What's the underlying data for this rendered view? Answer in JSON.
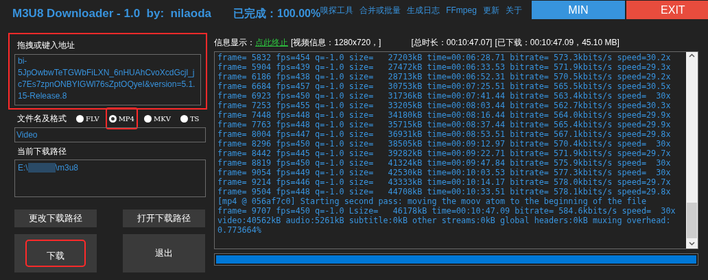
{
  "header": {
    "title": "M3U8 Downloader - 1.0  by:  nilaoda",
    "status": "已完成：100.00%"
  },
  "menu": [
    "嗅探工具",
    "合并或批量",
    "生成日志",
    "FFmpeg",
    "更新",
    "关于"
  ],
  "window_buttons": [
    {
      "label": "MIN",
      "kind": "min"
    },
    {
      "label": "EXIT",
      "kind": "exit"
    }
  ],
  "url_section": {
    "label": "拖拽或键入地址",
    "value": "bi-5JpOwbwTeTGWbFiLXN_6nHUAhCvoXcdGcjl_jc7Es7zpnONBYIGWl76sZptOQyeI&version=5.1.15-Release.8",
    "highlighted": true
  },
  "format": {
    "label": "文件名及格式",
    "options": [
      {
        "label": "FLV",
        "selected": false,
        "highlighted": false
      },
      {
        "label": "MP4",
        "selected": true,
        "highlighted": true
      },
      {
        "label": "MKV",
        "selected": false,
        "highlighted": false
      },
      {
        "label": "TS",
        "selected": false,
        "highlighted": false
      }
    ],
    "filename": "Video"
  },
  "path": {
    "label": "当前下载路径",
    "prefix": "E:\\",
    "suffix": "\\m3u8",
    "redacted": true
  },
  "buttons": [
    {
      "label": "更改下载路径",
      "kind": "small",
      "highlighted": false
    },
    {
      "label": "打开下载路径",
      "kind": "small",
      "highlighted": false
    },
    {
      "label": "下载",
      "kind": "large",
      "highlighted": true
    },
    {
      "label": "退出",
      "kind": "large",
      "highlighted": false
    }
  ],
  "info": {
    "label": "信息显示：",
    "stop_link": "点此终止",
    "video_info": "[视频信息：1280x720，]",
    "total_duration": "[总时长：00:10:47.07]",
    "downloaded": "[已下载：00:10:47.09，45.10 MB]"
  },
  "log": [
    "frame= 5832 fps=454 q=-1.0 size=   27203kB time=00:06:28.71 bitrate= 573.3kbits/s speed=30.2x",
    "frame= 5904 fps=439 q=-1.0 size=   27472kB time=00:06:33.53 bitrate= 571.9kbits/s speed=29.3x",
    "frame= 6186 fps=438 q=-1.0 size=   28713kB time=00:06:52.31 bitrate= 570.5kbits/s speed=29.2x",
    "frame= 6684 fps=457 q=-1.0 size=   30753kB time=00:07:25.51 bitrate= 565.5kbits/s speed=30.5x",
    "frame= 6923 fps=450 q=-1.0 size=   31736kB time=00:07:41.44 bitrate= 563.4kbits/s speed=  30x",
    "frame= 7253 fps=455 q=-1.0 size=   33205kB time=00:08:03.44 bitrate= 562.7kbits/s speed=30.3x",
    "frame= 7448 fps=448 q=-1.0 size=   34180kB time=00:08:16.44 bitrate= 564.0kbits/s speed=29.9x",
    "frame= 7763 fps=448 q=-1.0 size=   35715kB time=00:08:37.44 bitrate= 565.4kbits/s speed=29.9x",
    "frame= 8004 fps=447 q=-1.0 size=   36931kB time=00:08:53.51 bitrate= 567.1kbits/s speed=29.8x",
    "frame= 8296 fps=450 q=-1.0 size=   38505kB time=00:09:12.97 bitrate= 570.4kbits/s speed=  30x",
    "frame= 8442 fps=445 q=-1.0 size=   39282kB time=00:09:22.71 bitrate= 571.9kbits/s speed=29.7x",
    "frame= 8819 fps=450 q=-1.0 size=   41324kB time=00:09:47.84 bitrate= 575.9kbits/s speed=  30x",
    "frame= 9054 fps=449 q=-1.0 size=   42530kB time=00:10:03.53 bitrate= 577.3kbits/s speed=  30x",
    "frame= 9214 fps=446 q=-1.0 size=   43333kB time=00:10:14.17 bitrate= 578.0kbits/s speed=29.7x",
    "frame= 9504 fps=448 q=-1.0 size=   44708kB time=00:10:33.51 bitrate= 578.1kbits/s speed=29.8x",
    "[mp4 @ 056af7c0] Starting second pass: moving the moov atom to the beginning of the file",
    "frame= 9707 fps=450 q=-1.0 Lsize=   46178kB time=00:10:47.09 bitrate= 584.6kbits/s speed=  30x",
    "video:40562kB audio:5261kB subtitle:0kB other streams:0kB global headers:0kB muxing overhead:",
    "0.773664%"
  ],
  "progress": {
    "level": 1.0
  }
}
